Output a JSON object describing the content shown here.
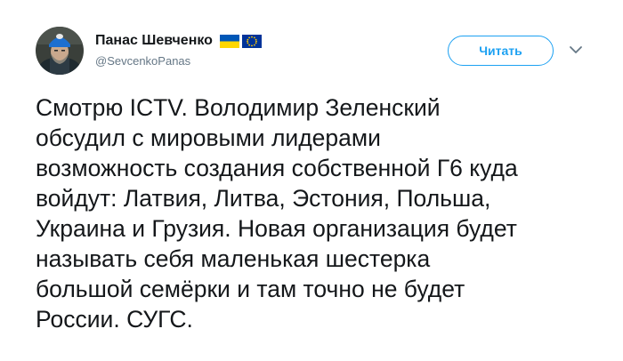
{
  "tweet": {
    "author": {
      "display_name": "Панас Шевченко",
      "handle": "@SevcenkoPanas",
      "flags": [
        {
          "icon": "ukraine-flag-icon",
          "colors": [
            "#0057b7",
            "#ffd700"
          ]
        },
        {
          "icon": "eu-flag-icon",
          "colors": [
            "#003399",
            "#ffcc00"
          ]
        }
      ]
    },
    "follow_label": "Читать",
    "more_icon": "chevron-down-icon",
    "text_lines": [
      "Смотрю ICTV. Володимир Зеленский",
      "обсудил с мировыми лидерами",
      "возможность создания собственной Г6 куда",
      "войдут: Латвия, Литва, Эстония, Польша,",
      "Украина и Грузия. Новая организация будет",
      "называть себя маленькая шестерка",
      "большой семёрки и там точно не будет",
      "России. СУГС."
    ],
    "accent_color": "#1da1f2"
  }
}
